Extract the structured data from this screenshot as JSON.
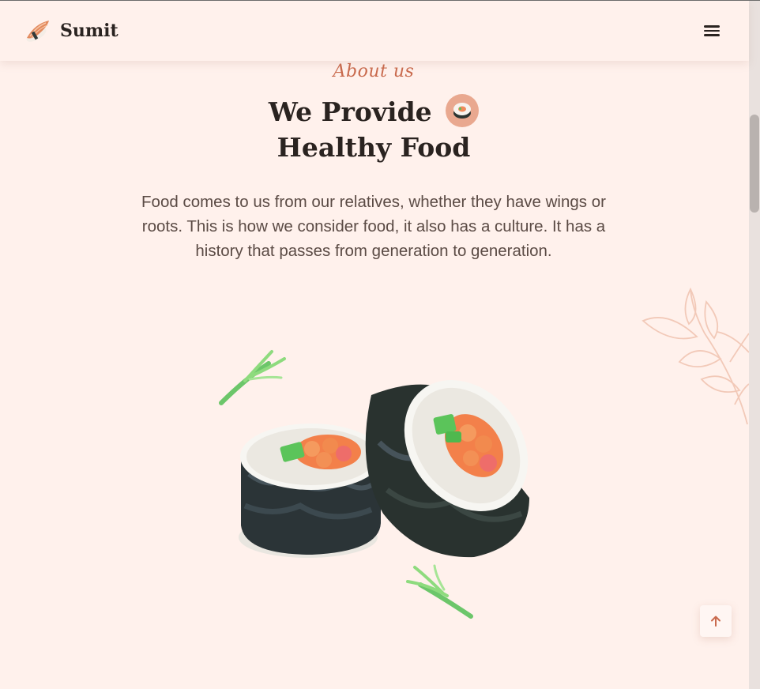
{
  "navbar": {
    "brand_name": "Sumit",
    "brand_logo_icon": "sushi-nigiri-icon",
    "menu_icon": "hamburger-menu-icon"
  },
  "about": {
    "subtitle": "About us",
    "title_line1": "We Provide",
    "title_line2": "Healthy Food",
    "title_badge_icon": "sushi-roll-icon",
    "description": "Food comes to us from our relatives, whether they have wings or roots. This is how we consider food, it also has a culture. It has a history that passes from generation to generation."
  },
  "scroll_top": {
    "icon": "arrow-up-icon"
  },
  "colors": {
    "background": "#fff1ec",
    "accent": "#c96a4d",
    "heading": "#2a2320",
    "body_text": "#5b4b45",
    "leaf_decoration": "#f2c9b8"
  }
}
